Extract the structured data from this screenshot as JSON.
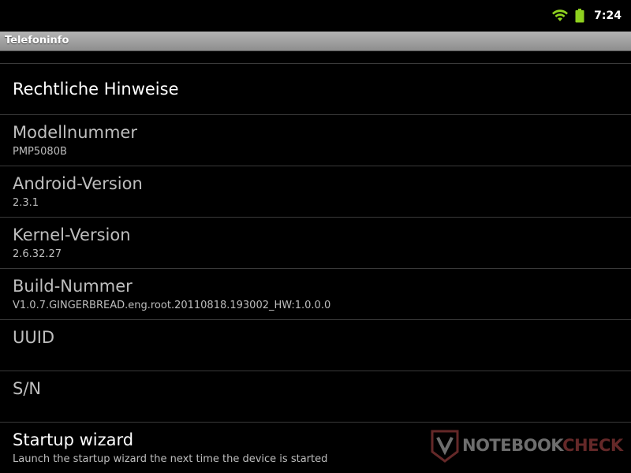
{
  "status_bar": {
    "time": "7:24",
    "wifi_icon": "wifi-icon",
    "battery_icon": "battery-icon",
    "accent": "#8fd11f"
  },
  "title_bar": {
    "title": "Telefoninfo"
  },
  "list": {
    "items": [
      {
        "label": "Rechtliche Hinweise",
        "value": "",
        "enabled": true
      },
      {
        "label": "Modellnummer",
        "value": "PMP5080B",
        "enabled": false
      },
      {
        "label": "Android-Version",
        "value": "2.3.1",
        "enabled": false
      },
      {
        "label": "Kernel-Version",
        "value": "2.6.32.27",
        "enabled": false
      },
      {
        "label": "Build-Nummer",
        "value": "V1.0.7.GINGERBREAD.eng.root.20110818.193002_HW:1.0.0.0",
        "enabled": false
      },
      {
        "label": "UUID",
        "value": "",
        "enabled": false
      },
      {
        "label": "S/N",
        "value": "",
        "enabled": false
      },
      {
        "label": "Startup wizard",
        "value": "Launch the startup wizard the next time the device is started",
        "enabled": true
      }
    ]
  },
  "watermark": {
    "text": "NOTEBOOK",
    "text2": "CHECK"
  }
}
